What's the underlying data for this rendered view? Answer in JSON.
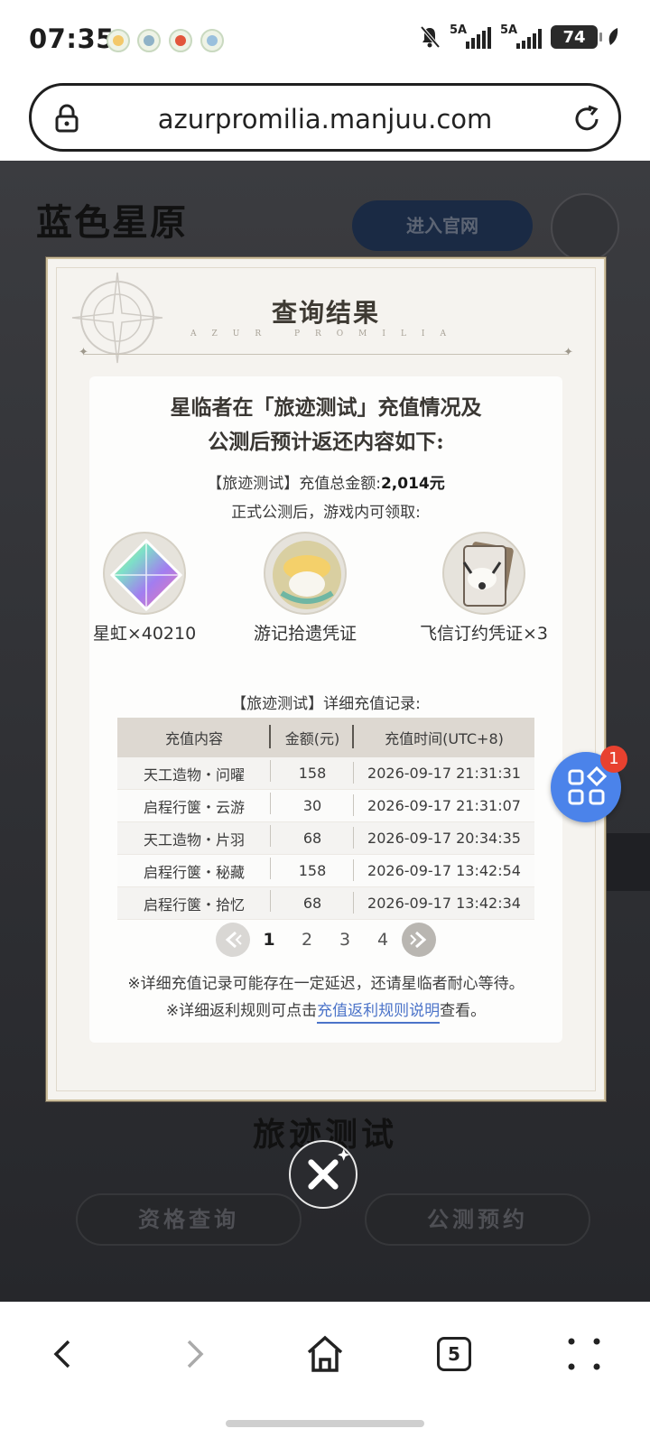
{
  "status_bar": {
    "time": "07:35",
    "notification_icons": [
      "app-notification-1-icon",
      "app-notification-2-icon",
      "app-notification-3-icon",
      "app-notification-4-icon"
    ],
    "signal_label_1": "5A",
    "signal_label_2": "5A",
    "battery": "74"
  },
  "browser": {
    "url": "azurpromilia.manjuu.com",
    "tabs_count": "5"
  },
  "background_page": {
    "logo": "蓝色星原",
    "enter_button": "进入官网",
    "section_title": "旅迹测试",
    "qualification_button": "资格查询",
    "preregister_button": "公测预约"
  },
  "modal": {
    "title": "查询结果",
    "subtitle": "AZUR PROMILIA",
    "heading_line1": "星临者在「旅迹测试」充值情况及",
    "heading_line2": "公测后预计返还内容如下:",
    "total_label": "【旅迹测试】充值总金额:",
    "total_value": "2,014元",
    "after_launch": "正式公测后，游戏内可领取:",
    "rewards": [
      {
        "label": "星虹×40210",
        "icon": "prism-crystal-icon"
      },
      {
        "label": "游记拾遗凭证",
        "icon": "bird-emblem-icon"
      },
      {
        "label": "飞信订约凭证×3",
        "icon": "card-creature-icon"
      }
    ],
    "detail_title": "【旅迹测试】详细充值记录:",
    "table": {
      "headers": [
        "充值内容",
        "金额(元)",
        "充值时间(UTC+8)"
      ],
      "rows": [
        [
          "天工造物・问曜",
          "158",
          "2026-09-17 21:31:31"
        ],
        [
          "启程行箧・云游",
          "30",
          "2026-09-17 21:31:07"
        ],
        [
          "天工造物・片羽",
          "68",
          "2026-09-17 20:34:35"
        ],
        [
          "启程行箧・秘藏",
          "158",
          "2026-09-17 13:42:54"
        ],
        [
          "启程行箧・拾忆",
          "68",
          "2026-09-17 13:42:34"
        ]
      ]
    },
    "pagination": {
      "pages": [
        "1",
        "2",
        "3",
        "4"
      ],
      "current": "1"
    },
    "note1": "※详细充值记录可能存在一定延迟，还请星临者耐心等待。",
    "note2_prefix": "※详细返利规则可点击",
    "note2_link": "充值返利规则说明",
    "note2_suffix": "查看。"
  },
  "floating_button": {
    "badge": "1"
  },
  "colors": {
    "link": "#4c74c9",
    "fab": "#4b83ea",
    "badge": "#e8412f",
    "table_header": "#ddd8d1"
  }
}
